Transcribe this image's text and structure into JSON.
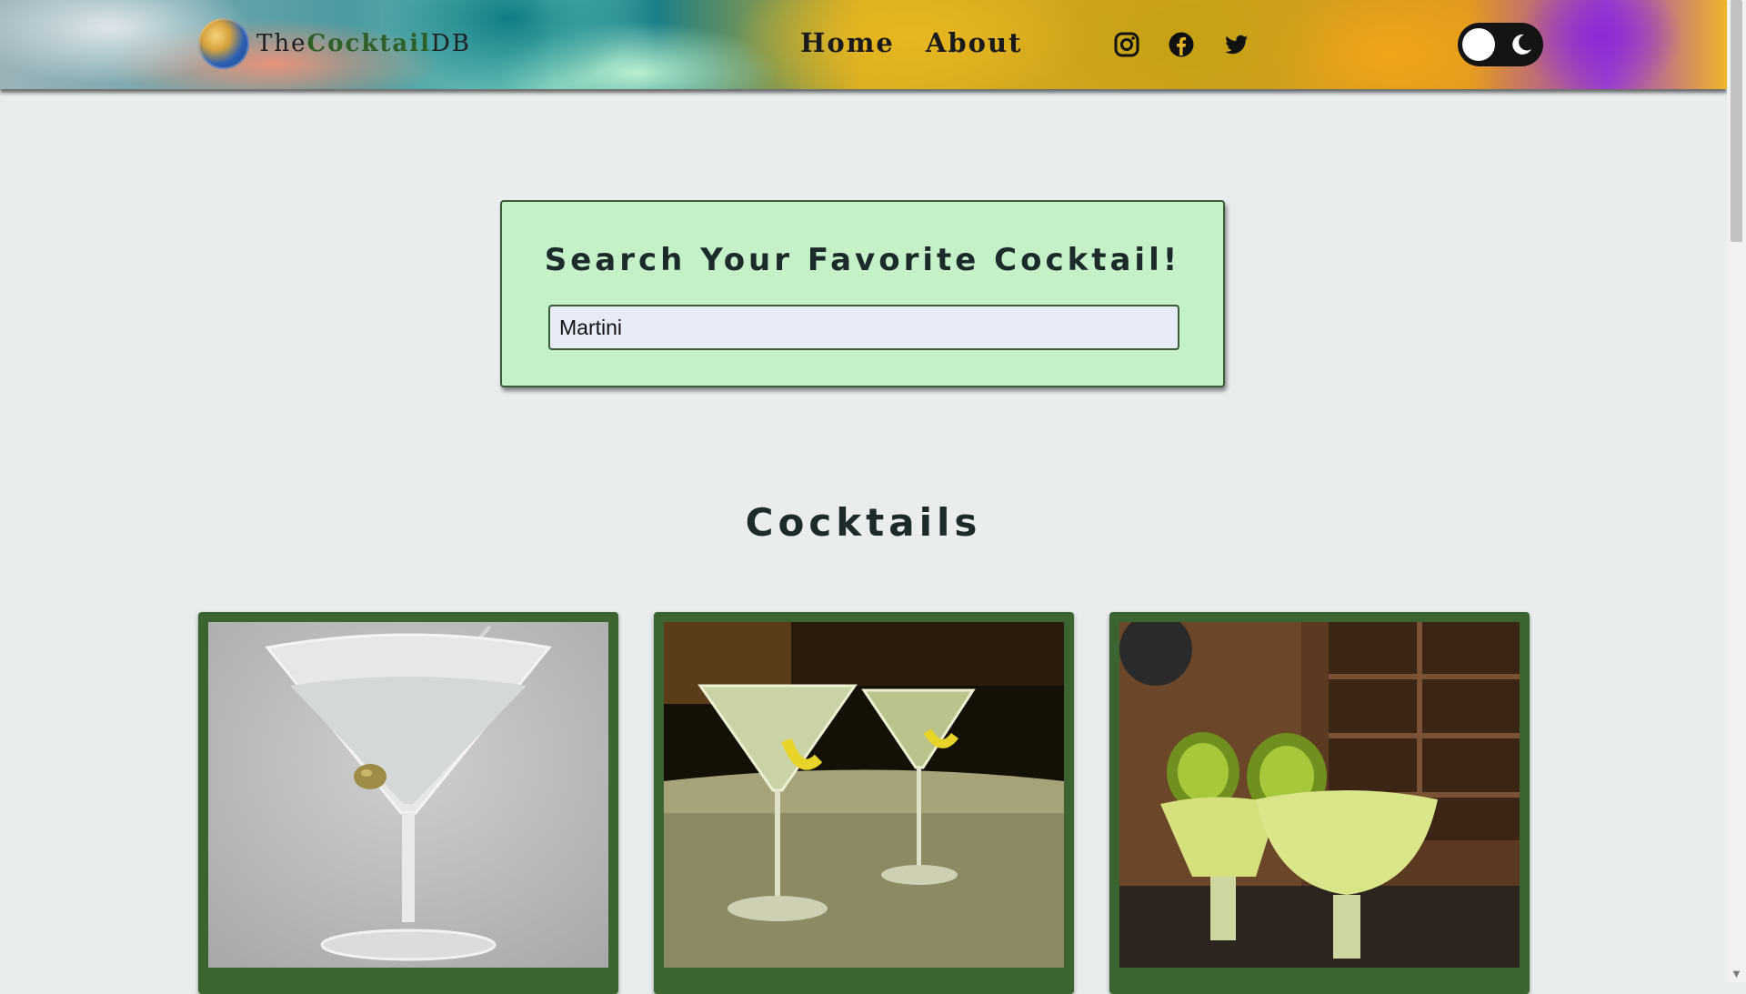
{
  "brand": {
    "prefix": "The",
    "accent": "Cocktail",
    "suffix": "DB"
  },
  "nav": {
    "items": [
      {
        "label": "Home"
      },
      {
        "label": "About"
      }
    ]
  },
  "socials": [
    {
      "icon": "instagram-icon"
    },
    {
      "icon": "facebook-icon"
    },
    {
      "icon": "twitter-icon"
    }
  ],
  "theme_toggle": {
    "state": "light",
    "icon": "moon-icon"
  },
  "search": {
    "title": "Search Your Favorite Cocktail!",
    "value": "Martini"
  },
  "cocktails_section": {
    "title": "Cocktails"
  },
  "cards": [
    {
      "image": "martini-with-olive"
    },
    {
      "image": "two-martinis-with-lemon-twist"
    },
    {
      "image": "kiwi-cocktails-at-bar"
    }
  ],
  "colors": {
    "accent": "#3c6430",
    "search_bg": "#c4f1c8",
    "page_bg": "#e9edee"
  }
}
